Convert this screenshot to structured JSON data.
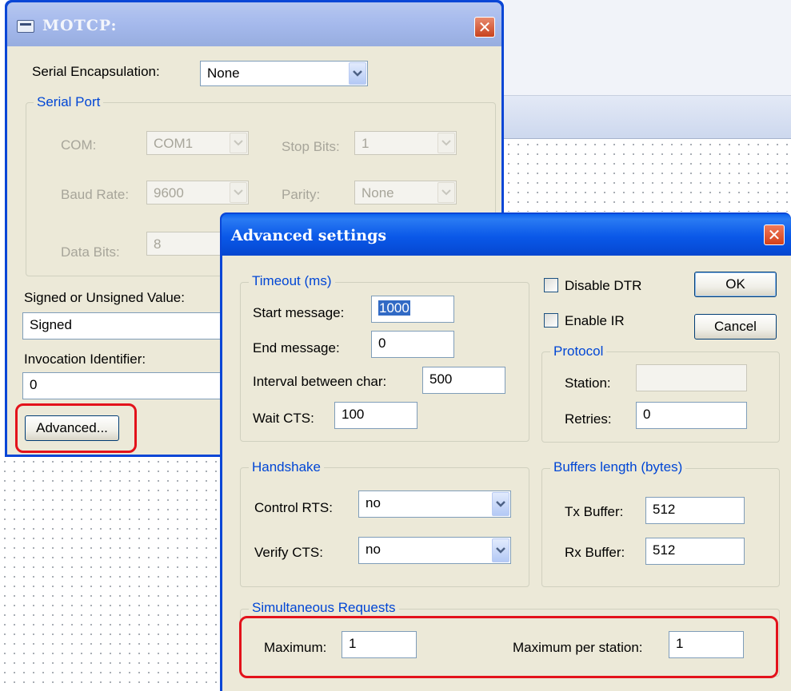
{
  "motcp": {
    "title": "MOTCP:",
    "serial_encapsulation_label": "Serial Encapsulation:",
    "serial_encapsulation_value": "None",
    "serial_port_group": "Serial Port",
    "com_label": "COM:",
    "com_value": "COM1",
    "stop_bits_label": "Stop Bits:",
    "stop_bits_value": "1",
    "baud_rate_label": "Baud Rate:",
    "baud_rate_value": "9600",
    "parity_label": "Parity:",
    "parity_value": "None",
    "data_bits_label": "Data Bits:",
    "data_bits_value": "8",
    "signed_label": "Signed or Unsigned Value:",
    "signed_value": "Signed",
    "invocation_label": "Invocation Identifier:",
    "invocation_value": "0",
    "advanced_button": "Advanced..."
  },
  "advanced": {
    "title": "Advanced settings",
    "timeout_group": "Timeout (ms)",
    "start_message_label": "Start message:",
    "start_message_value": "1000",
    "end_message_label": "End message:",
    "end_message_value": "0",
    "interval_label": "Interval between char:",
    "interval_value": "500",
    "wait_cts_label": "Wait CTS:",
    "wait_cts_value": "100",
    "disable_dtr_label": "Disable DTR",
    "enable_ir_label": "Enable IR",
    "ok_button": "OK",
    "cancel_button": "Cancel",
    "protocol_group": "Protocol",
    "station_label": "Station:",
    "station_value": "",
    "retries_label": "Retries:",
    "retries_value": "0",
    "handshake_group": "Handshake",
    "control_rts_label": "Control RTS:",
    "control_rts_value": "no",
    "verify_cts_label": "Verify CTS:",
    "verify_cts_value": "no",
    "buffers_group": "Buffers length (bytes)",
    "tx_buffer_label": "Tx Buffer:",
    "tx_buffer_value": "512",
    "rx_buffer_label": "Rx Buffer:",
    "rx_buffer_value": "512",
    "simultaneous_group": "Simultaneous Requests",
    "maximum_label": "Maximum:",
    "maximum_value": "1",
    "max_per_station_label": "Maximum per station:",
    "max_per_station_value": "1"
  },
  "icons": {
    "window_icon": "window-icon",
    "close": "close-icon",
    "dropdown": "chevron-down-icon"
  },
  "colors": {
    "highlight_outline": "#e3121b",
    "title_bar": "#0a58e8",
    "group_legend": "#0046d5"
  }
}
